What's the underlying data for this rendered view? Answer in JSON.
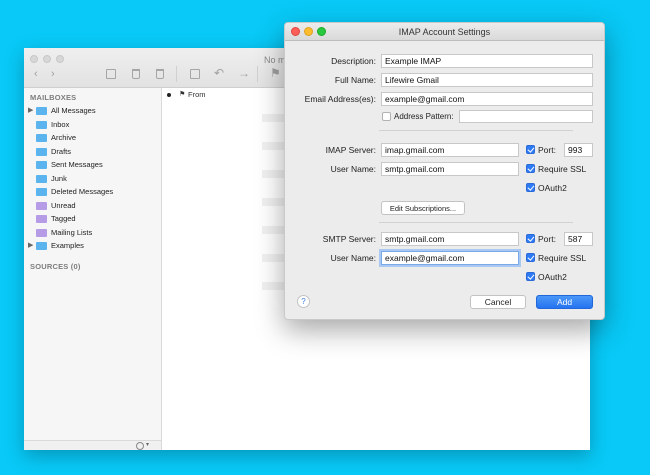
{
  "mail": {
    "toolbar": {
      "no_message": "No m"
    },
    "sidebar": {
      "mailboxes_header": "MAILBOXES",
      "items": [
        {
          "label": "All Messages",
          "disclosure": "▶",
          "icon": "folder-icon"
        },
        {
          "label": "Inbox",
          "icon": "folder-icon"
        },
        {
          "label": "Archive",
          "icon": "folder-icon"
        },
        {
          "label": "Drafts",
          "icon": "folder-icon"
        },
        {
          "label": "Sent Messages",
          "icon": "folder-icon"
        },
        {
          "label": "Junk",
          "icon": "folder-icon"
        },
        {
          "label": "Deleted Messages",
          "icon": "folder-icon"
        },
        {
          "label": "Unread",
          "icon": "smart-mailbox-icon"
        },
        {
          "label": "Tagged",
          "icon": "smart-mailbox-icon"
        },
        {
          "label": "Mailing Lists",
          "icon": "smart-mailbox-icon"
        },
        {
          "label": "Examples",
          "disclosure": "▶",
          "icon": "folder-icon"
        }
      ],
      "sources_header": "SOURCES (0)"
    },
    "list": {
      "from_header": "From",
      "flag_glyph": "⚑"
    }
  },
  "dialog": {
    "title": "IMAP Account Settings",
    "description": {
      "label": "Description:",
      "value": "Example IMAP"
    },
    "full_name": {
      "label": "Full Name:",
      "value": "Lifewire Gmail"
    },
    "email": {
      "label": "Email Address(es):",
      "value": "example@gmail.com"
    },
    "address_pattern": {
      "label": "Address Pattern:",
      "checked": false
    },
    "imap": {
      "server_label": "IMAP Server:",
      "server": "imap.gmail.com",
      "user_label": "User Name:",
      "user": "smtp.gmail.com",
      "port_label": "Port:",
      "port": "993",
      "ssl_label": "Require SSL",
      "oauth_label": "OAuth2"
    },
    "edit_subscriptions": "Edit Subscriptions...",
    "smtp": {
      "server_label": "SMTP Server:",
      "server": "smtp.gmail.com",
      "user_label": "User Name:",
      "user": "example@gmail.com",
      "port_label": "Port:",
      "port": "587",
      "ssl_label": "Require SSL",
      "oauth_label": "OAuth2"
    },
    "help_label": "?",
    "cancel_label": "Cancel",
    "add_label": "Add"
  },
  "colors": {
    "background": "#08c9f7",
    "accent": "#2f7bf5",
    "folder": "#5cb4ef",
    "smart_folder": "#b69ce6"
  }
}
